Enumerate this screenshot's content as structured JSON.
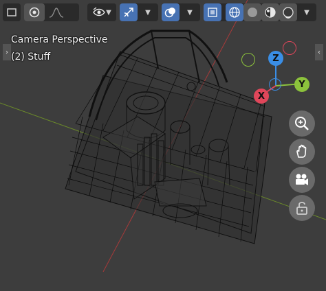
{
  "viewport": {
    "view_name": "Camera Perspective",
    "collection_label": "(2) Stuff"
  },
  "header": {
    "buttons": [
      {
        "icon": "select-mode-icon"
      },
      {
        "icon": "proportional-editing-icon"
      },
      {
        "icon": "falloff-curve-icon"
      },
      {
        "icon": "visibility-eye-icon"
      },
      {
        "icon": "gizmo-toggle-icon"
      },
      {
        "icon": "overlays-icon"
      },
      {
        "icon": "xray-toggle-icon"
      },
      {
        "icon": "shading-wireframe-icon"
      },
      {
        "icon": "shading-solid-icon"
      },
      {
        "icon": "shading-material-icon"
      },
      {
        "icon": "shading-rendered-icon"
      }
    ]
  },
  "gizmo": {
    "x_label": "X",
    "y_label": "Y",
    "z_label": "Z",
    "colors": {
      "x": "#e0465a",
      "y": "#8cc23c",
      "z": "#3a8ee6"
    }
  },
  "navigation": {
    "icons": [
      "zoom-icon",
      "pan-hand-icon",
      "camera-view-icon",
      "lock-camera-icon"
    ]
  },
  "colors": {
    "background": "#3d3d3d",
    "wire": "#111111",
    "x_axis_line": "#a83a3a",
    "y_axis_line": "#6b8a2a",
    "active_button": "#4772b3"
  }
}
